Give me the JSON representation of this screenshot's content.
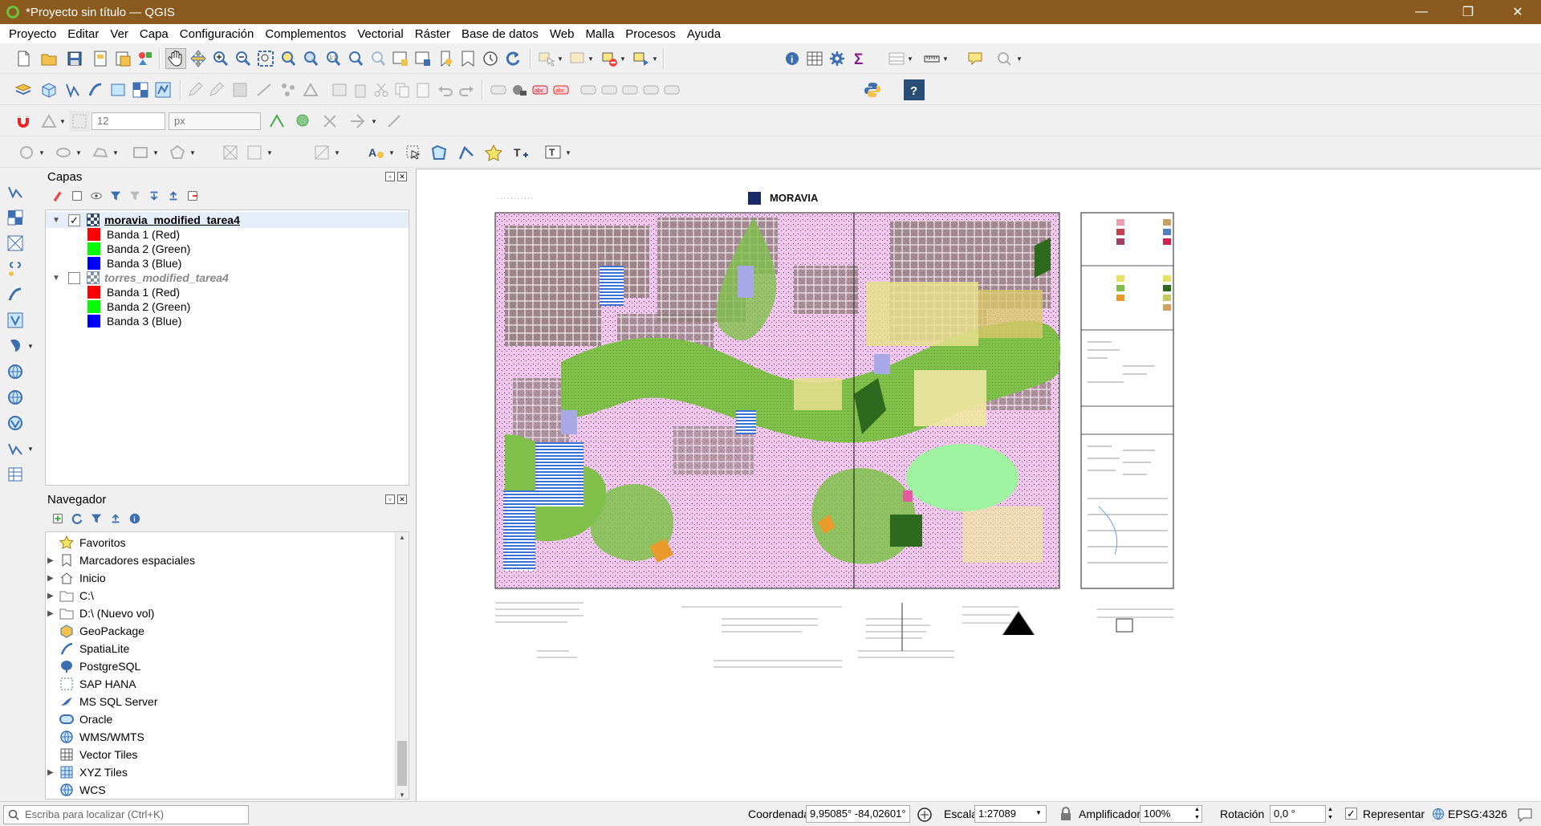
{
  "window": {
    "title": "*Proyecto sin título — QGIS",
    "minimize": "—",
    "maximize": "❐",
    "close": "✕"
  },
  "menu": [
    "Proyecto",
    "Editar",
    "Ver",
    "Capa",
    "Configuración",
    "Complementos",
    "Vectorial",
    "Ráster",
    "Base de datos",
    "Web",
    "Malla",
    "Procesos",
    "Ayuda"
  ],
  "snapping": {
    "size_value": "12",
    "unit_value": "px"
  },
  "layers_panel": {
    "title": "Capas",
    "layers": [
      {
        "name": "moravia_modified_tarea4",
        "checked": "✓",
        "bands": [
          {
            "label": "Banda 1 (Red)",
            "color": "#ff0000"
          },
          {
            "label": "Banda 2 (Green)",
            "color": "#00ff00"
          },
          {
            "label": "Banda 3 (Blue)",
            "color": "#0000ff"
          }
        ]
      },
      {
        "name": "torres_modified_tarea4",
        "checked": "",
        "bands": [
          {
            "label": "Banda 1 (Red)",
            "color": "#ff0000"
          },
          {
            "label": "Banda 2 (Green)",
            "color": "#00ff00"
          },
          {
            "label": "Banda 3 (Blue)",
            "color": "#0000ff"
          }
        ]
      }
    ]
  },
  "browser_panel": {
    "title": "Navegador",
    "items": [
      {
        "label": "Favoritos",
        "icon": "star-icon",
        "expandable": false
      },
      {
        "label": "Marcadores espaciales",
        "icon": "bookmarks-icon",
        "expandable": true
      },
      {
        "label": "Inicio",
        "icon": "home-icon",
        "expandable": true
      },
      {
        "label": "C:\\",
        "icon": "folder-icon",
        "expandable": true
      },
      {
        "label": "D:\\ (Nuevo vol)",
        "icon": "folder-icon",
        "expandable": true
      },
      {
        "label": "GeoPackage",
        "icon": "geopackage-icon",
        "expandable": false
      },
      {
        "label": "SpatiaLite",
        "icon": "spatialite-icon",
        "expandable": false
      },
      {
        "label": "PostgreSQL",
        "icon": "postgresql-icon",
        "expandable": false
      },
      {
        "label": "SAP HANA",
        "icon": "sap-hana-icon",
        "expandable": false
      },
      {
        "label": "MS SQL Server",
        "icon": "mssql-icon",
        "expandable": false
      },
      {
        "label": "Oracle",
        "icon": "oracle-icon",
        "expandable": false
      },
      {
        "label": "WMS/WMTS",
        "icon": "wms-icon",
        "expandable": false
      },
      {
        "label": "Vector Tiles",
        "icon": "vector-tiles-icon",
        "expandable": false
      },
      {
        "label": "XYZ Tiles",
        "icon": "xyz-tiles-icon",
        "expandable": true
      },
      {
        "label": "WCS",
        "icon": "wcs-icon",
        "expandable": false
      }
    ]
  },
  "map": {
    "sheet_title": "MORAVIA"
  },
  "statusbar": {
    "locator_placeholder": "Escriba para localizar (Ctrl+K)",
    "coord_label": "Coordenada",
    "coord_value": "9,95085° -84,02601°",
    "scale_label": "Escala",
    "scale_value": "1:27089",
    "magnifier_label": "Amplificador",
    "magnifier_value": "100%",
    "rotation_label": "Rotación",
    "rotation_value": "0,0 °",
    "render_label": "Representar",
    "render_checked": "✓",
    "crs": "EPSG:4326"
  }
}
